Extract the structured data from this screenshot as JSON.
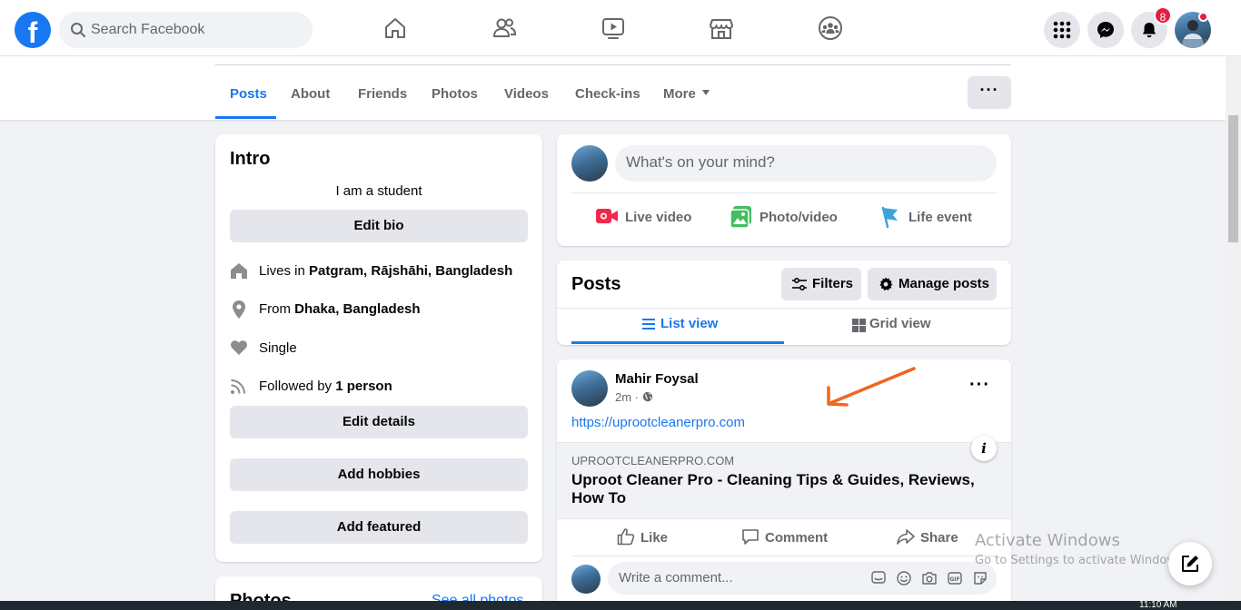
{
  "topnav": {
    "logo": "f",
    "search_placeholder": "Search Facebook",
    "notification_count": "8",
    "icons": [
      "home-icon",
      "friends-icon",
      "watch-icon",
      "marketplace-icon",
      "groups-icon",
      "menu-grid-icon",
      "messenger-icon",
      "bell-icon"
    ]
  },
  "profile_tabs": {
    "items": [
      "Posts",
      "About",
      "Friends",
      "Photos",
      "Videos",
      "Check-ins",
      "More"
    ],
    "active": "Posts"
  },
  "intro": {
    "title": "Intro",
    "bio": "I am a student",
    "edit_bio": "Edit bio",
    "lives_prefix": "Lives in",
    "lives_value": "Patgram, Rājshāhi, Bangladesh",
    "from_prefix": "From",
    "from_value": "Dhaka, Bangladesh",
    "relationship": "Single",
    "followed_prefix": "Followed by",
    "followed_value": "1 person",
    "edit_details": "Edit details",
    "add_hobbies": "Add hobbies",
    "add_featured": "Add featured"
  },
  "photos_card": {
    "title": "Photos",
    "see_all": "See all photos"
  },
  "composer": {
    "placeholder": "What's on your mind?",
    "live_video": "Live video",
    "photo_video": "Photo/video",
    "life_event": "Life event"
  },
  "posts_header": {
    "title": "Posts",
    "filters": "Filters",
    "manage": "Manage posts",
    "list_view": "List view",
    "grid_view": "Grid view",
    "active_view": "List view"
  },
  "post": {
    "author": "Mahir Foysal",
    "time": "2m ·",
    "link": "https://uprootcleanerpro.com",
    "preview_domain": "UPROOTCLEANERPRO.COM",
    "preview_title": "Uproot Cleaner Pro - Cleaning Tips & Guides, Reviews, How To",
    "like": "Like",
    "comment": "Comment",
    "share": "Share",
    "comment_placeholder": "Write a comment..."
  },
  "overlay": {
    "activate_title": "Activate Windows",
    "activate_sub": "Go to Settings to activate Windows.",
    "clock": "11:10 AM"
  },
  "colors": {
    "brand": "#1877f2",
    "annotation_arrow": "#f26522",
    "badge": "#e41e3f",
    "live_video": "#f02849",
    "photo_video": "#45bd62",
    "life_event": "#3ea3d8"
  }
}
